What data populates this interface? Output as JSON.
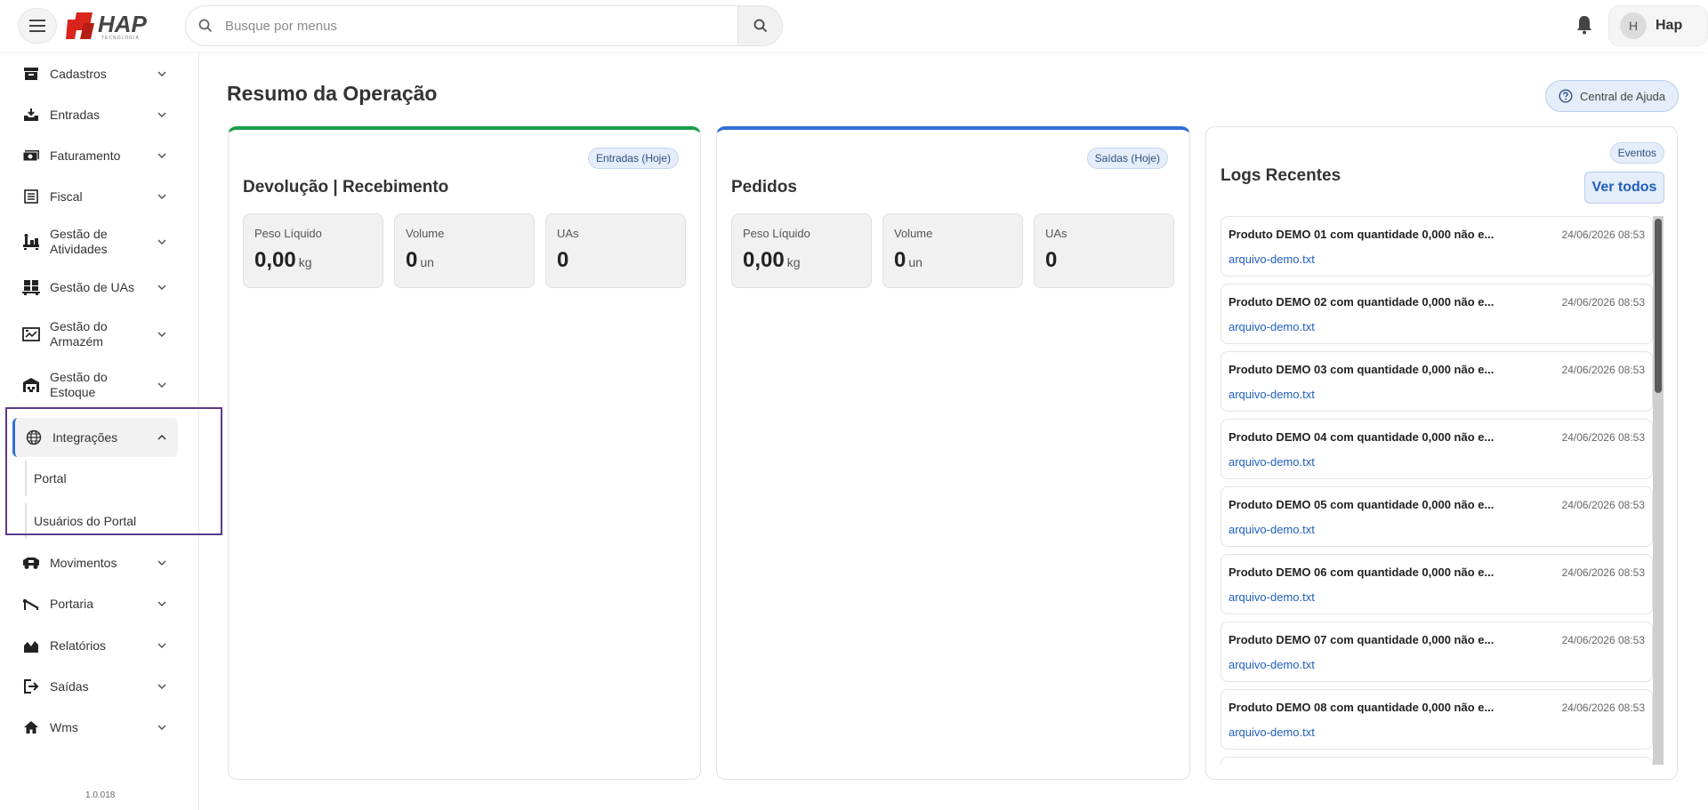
{
  "header": {
    "search_placeholder": "Busque por menus",
    "logo_text": "HAP",
    "logo_subtext": "TECNOLOGIA",
    "user_initial": "H",
    "user_name": "Hap"
  },
  "sidebar": {
    "items": [
      {
        "label": "Cadastros",
        "icon": "archive-icon"
      },
      {
        "label": "Entradas",
        "icon": "inbox-icon"
      },
      {
        "label": "Faturamento",
        "icon": "money-icon"
      },
      {
        "label": "Fiscal",
        "icon": "list-icon"
      },
      {
        "label": "Gestão de Atividades",
        "icon": "tasks-icon"
      },
      {
        "label": "Gestão de UAs",
        "icon": "pallet-icon"
      },
      {
        "label": "Gestão do Armazém",
        "icon": "warehouse-map-icon"
      },
      {
        "label": "Gestão do Estoque",
        "icon": "warehouse-icon"
      },
      {
        "label": "Integrações",
        "icon": "globe-icon"
      },
      {
        "label": "Movimentos",
        "icon": "truck-icon"
      },
      {
        "label": "Portaria",
        "icon": "barrier-icon"
      },
      {
        "label": "Relatórios",
        "icon": "chart-icon"
      },
      {
        "label": "Saídas",
        "icon": "exit-icon"
      },
      {
        "label": "Wms",
        "icon": "home-icon"
      }
    ],
    "sub_items": [
      "Portal",
      "Usuários do Portal"
    ],
    "version": "1.0.018"
  },
  "main": {
    "title": "Resumo da Operação",
    "help_label": "Central de Ajuda"
  },
  "cards": {
    "entradas": {
      "badge": "Entradas (Hoje)",
      "title": "Devolução | Recebimento",
      "stats": [
        {
          "label": "Peso Líquido",
          "value": "0,00",
          "unit": "kg"
        },
        {
          "label": "Volume",
          "value": "0",
          "unit": "un"
        },
        {
          "label": "UAs",
          "value": "0",
          "unit": ""
        }
      ]
    },
    "saidas": {
      "badge": "Saídas (Hoje)",
      "title": "Pedidos",
      "stats": [
        {
          "label": "Peso Líquido",
          "value": "0,00",
          "unit": "kg"
        },
        {
          "label": "Volume",
          "value": "0",
          "unit": "un"
        },
        {
          "label": "UAs",
          "value": "0",
          "unit": ""
        }
      ]
    }
  },
  "logs": {
    "badge": "Eventos",
    "title": "Logs Recentes",
    "view_all": "Ver todos",
    "items": [
      {
        "title": "Produto DEMO 01 com quantidade 0,000 não e...",
        "date": "24/06/2026 08:53",
        "file": "arquivo-demo.txt"
      },
      {
        "title": "Produto DEMO 02  com quantidade 0,000 não e...",
        "date": "24/06/2026 08:53",
        "file": "arquivo-demo.txt"
      },
      {
        "title": "Produto DEMO 03  com quantidade 0,000 não e...",
        "date": "24/06/2026 08:53",
        "file": "arquivo-demo.txt"
      },
      {
        "title": "Produto DEMO 04  com quantidade 0,000 não e...",
        "date": "24/06/2026 08:53",
        "file": "arquivo-demo.txt"
      },
      {
        "title": "Produto DEMO 05  com quantidade 0,000 não e...",
        "date": "24/06/2026 08:53",
        "file": "arquivo-demo.txt"
      },
      {
        "title": "Produto DEMO 06  com quantidade 0,000 não e...",
        "date": "24/06/2026 08:53",
        "file": "arquivo-demo.txt"
      },
      {
        "title": "Produto DEMO 07  com quantidade 0,000 não e...",
        "date": "24/06/2026 08:53",
        "file": "arquivo-demo.txt"
      },
      {
        "title": "Produto DEMO 08  com quantidade 0,000 não e...",
        "date": "24/06/2026 08:53",
        "file": "arquivo-demo.txt"
      }
    ]
  },
  "colors": {
    "accent": "#2f6fd6",
    "green": "#1a9e4a",
    "logo_red": "#d9261c",
    "highlight": "#5b3a8c"
  }
}
